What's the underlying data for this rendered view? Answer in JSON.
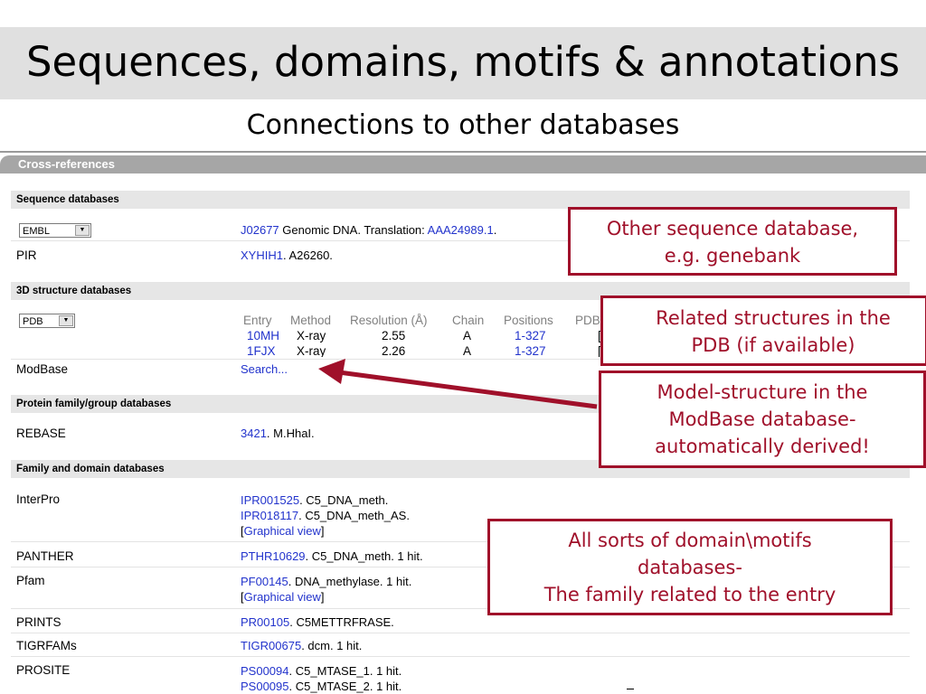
{
  "title": "Sequences, domains, motifs & annotations",
  "subtitle": "Connections to other databases",
  "panel_header": "Cross-references",
  "sections": {
    "sequence": "Sequence databases",
    "structure": "3D structure databases",
    "protein_family": "Protein family/group databases",
    "family_domain": "Family and domain databases"
  },
  "embl": {
    "select": "EMBL",
    "id": "J02677",
    "text1": " Genomic DNA. Translation: ",
    "translation": "AAA24989.1",
    "text2": "."
  },
  "pir": {
    "name": "PIR",
    "id": "XYHIH1",
    "text": ". A26260."
  },
  "pdb": {
    "select": "PDB",
    "headers": [
      "Entry",
      "Method",
      "Resolution (Å)",
      "Chain",
      "Positions",
      "PDBsum"
    ],
    "rows": [
      {
        "entry": "10MH",
        "method": "X-ray",
        "resolution": "2.55",
        "chain": "A",
        "positions": "1-327",
        "pdbsum": "[»]"
      },
      {
        "entry": "1FJX",
        "method": "X-ray",
        "resolution": "2.26",
        "chain": "A",
        "positions": "1-327",
        "pdbsum": "[»]"
      }
    ]
  },
  "modbase": {
    "name": "ModBase",
    "link": "Search..."
  },
  "rebase": {
    "name": "REBASE",
    "id": "3421",
    "text": ". M.HhaI."
  },
  "interpro": {
    "name": "InterPro",
    "id1": "IPR001525",
    "text1": ". C5_DNA_meth.",
    "id2": "IPR018117",
    "text2": ". C5_DNA_meth_AS.",
    "graphical": "Graphical view"
  },
  "panther": {
    "name": "PANTHER",
    "id": "PTHR10629",
    "text": ". C5_DNA_meth. 1 hit."
  },
  "pfam": {
    "name": "Pfam",
    "id": "PF00145",
    "text": ". DNA_methylase. 1 hit.",
    "graphical": "Graphical view"
  },
  "prints": {
    "name": "PRINTS",
    "id": "PR00105",
    "text": ". C5METTRFRASE."
  },
  "tigrfams": {
    "name": "TIGRFAMs",
    "id": "TIGR00675",
    "text": ". dcm. 1 hit."
  },
  "prosite": {
    "name": "PROSITE",
    "id1": "PS00094",
    "text1": ". C5_MTASE_1. 1 hit.",
    "id2": "PS00095",
    "text2": ". C5_MTASE_2. 1 hit."
  },
  "callouts": {
    "seq": [
      "Other sequence database,",
      "e.g. genebank"
    ],
    "pdb": [
      "Related structures in the",
      "PDB (if available)"
    ],
    "modbase": [
      "Model-structure in the",
      "ModBase database-",
      "automatically derived!"
    ],
    "domains": [
      "All sorts of domain\\motifs",
      "databases-",
      "The family related to the entry"
    ]
  },
  "colors": {
    "callout": "#a0102a",
    "link": "#2233cc",
    "header_bar": "#a6a6a6",
    "section_bar": "#e6e6e6"
  }
}
